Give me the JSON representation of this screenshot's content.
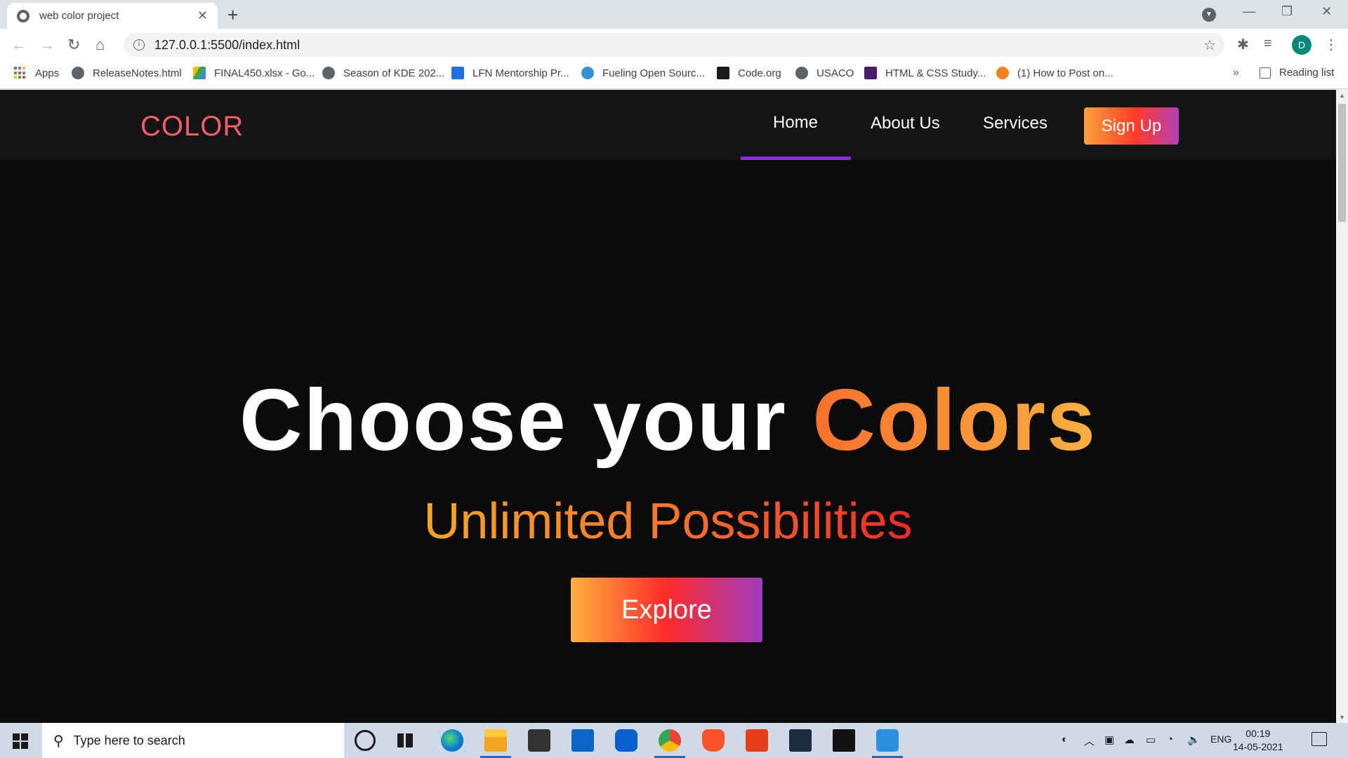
{
  "browser": {
    "tab_title": "web color project",
    "tab_close": "✕",
    "new_tab": "+",
    "url": "127.0.0.1:5500/index.html",
    "bookmarks": [
      {
        "label": "Apps"
      },
      {
        "label": "ReleaseNotes.html"
      },
      {
        "label": "FINAL450.xlsx - Go..."
      },
      {
        "label": "Season of KDE 202..."
      },
      {
        "label": "LFN Mentorship Pr..."
      },
      {
        "label": "Fueling Open Sourc..."
      },
      {
        "label": "Code.org"
      },
      {
        "label": "USACO"
      },
      {
        "label": "HTML & CSS Study..."
      },
      {
        "label": "(1) How to Post on..."
      }
    ],
    "bookmarks_overflow": "»",
    "reading_list": "Reading list",
    "profile_initial": "D"
  },
  "site": {
    "logo": "COLOR",
    "nav": {
      "home": "Home",
      "about": "About Us",
      "services": "Services",
      "signup": "Sign Up"
    },
    "hero": {
      "title_main": "Choose your ",
      "title_accent": "Colors",
      "subtitle": "Unlimited Possibilities",
      "cta": "Explore"
    },
    "colors": {
      "logo": "#f25d6a",
      "active_underline": "#8a2be2",
      "background": "#0b0b0b",
      "nav_background": "#141414"
    }
  },
  "taskbar": {
    "search_placeholder": "Type here to search",
    "language": "ENG",
    "time": "00:19",
    "date": "14-05-2021"
  }
}
